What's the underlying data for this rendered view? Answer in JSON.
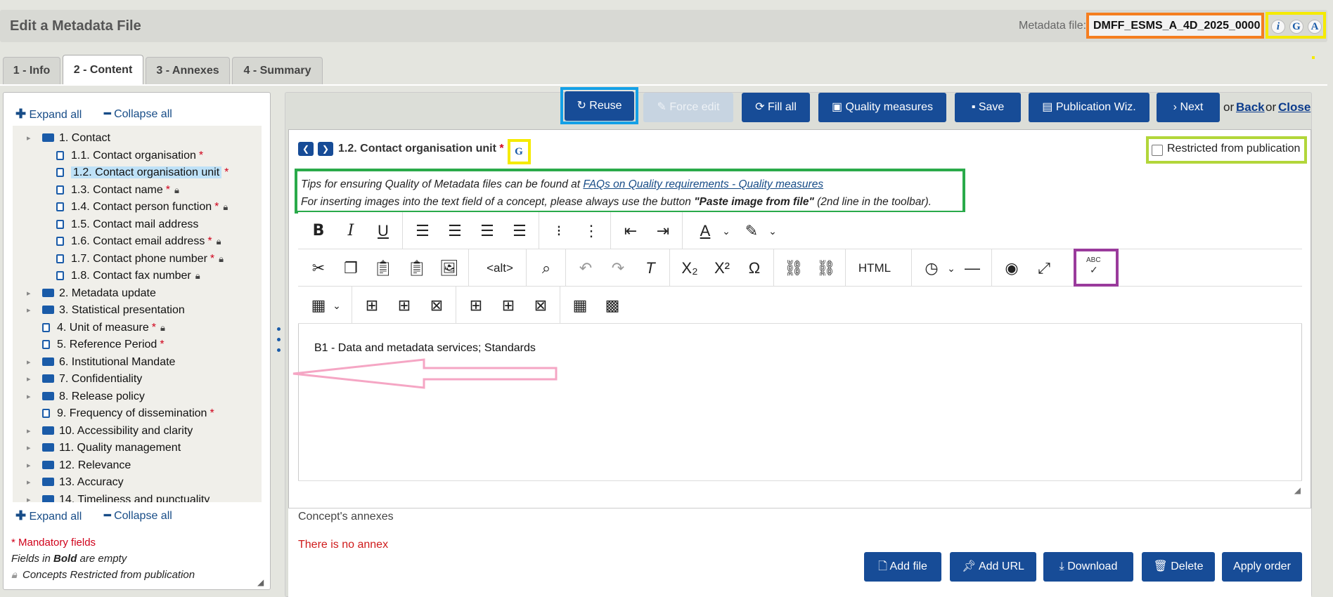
{
  "page": {
    "title": "Edit a Metadata File",
    "metadata_label": "Metadata file:",
    "metadata_id": "DMFF_ESMS_A_4D_2025_0000",
    "help_icons": [
      "i",
      "G",
      "A"
    ]
  },
  "tabs": [
    "1 - Info",
    "2 - Content",
    "3 - Annexes",
    "4 - Summary"
  ],
  "tree_controls": {
    "expand": "Expand all",
    "collapse": "Collapse all"
  },
  "tree": [
    {
      "label": "1. Contact",
      "type": "folder",
      "level": 0
    },
    {
      "label": "1.1. Contact organisation",
      "type": "doc",
      "level": 1,
      "mandatory": true
    },
    {
      "label": "1.2. Contact organisation unit",
      "type": "doc",
      "level": 1,
      "mandatory": true,
      "selected": true
    },
    {
      "label": "1.3. Contact name",
      "type": "doc",
      "level": 1,
      "mandatory": true,
      "restricted": true
    },
    {
      "label": "1.4. Contact person function",
      "type": "doc",
      "level": 1,
      "mandatory": true,
      "restricted": true
    },
    {
      "label": "1.5. Contact mail address",
      "type": "doc",
      "level": 1
    },
    {
      "label": "1.6. Contact email address",
      "type": "doc",
      "level": 1,
      "mandatory": true,
      "restricted": true
    },
    {
      "label": "1.7. Contact phone number",
      "type": "doc",
      "level": 1,
      "mandatory": true,
      "restricted": true
    },
    {
      "label": "1.8. Contact fax number",
      "type": "doc",
      "level": 1,
      "restricted": true
    },
    {
      "label": "2. Metadata update",
      "type": "folder",
      "level": 0
    },
    {
      "label": "3. Statistical presentation",
      "type": "folder",
      "level": 0
    },
    {
      "label": "4. Unit of measure",
      "type": "doc",
      "level": 0,
      "mandatory": true,
      "restricted": true
    },
    {
      "label": "5. Reference Period",
      "type": "doc",
      "level": 0,
      "mandatory": true
    },
    {
      "label": "6. Institutional Mandate",
      "type": "folder",
      "level": 0
    },
    {
      "label": "7. Confidentiality",
      "type": "folder",
      "level": 0
    },
    {
      "label": "8. Release policy",
      "type": "folder",
      "level": 0
    },
    {
      "label": "9. Frequency of dissemination",
      "type": "doc",
      "level": 0,
      "mandatory": true
    },
    {
      "label": "10. Accessibility and clarity",
      "type": "folder",
      "level": 0
    },
    {
      "label": "11. Quality management",
      "type": "folder",
      "level": 0
    },
    {
      "label": "12. Relevance",
      "type": "folder",
      "level": 0
    },
    {
      "label": "13. Accuracy",
      "type": "folder",
      "level": 0
    },
    {
      "label": "14. Timeliness and punctuality",
      "type": "folder",
      "level": 0
    }
  ],
  "legend": {
    "mandatory": "* Mandatory fields",
    "bold_prefix": "Fields in ",
    "bold_word": "Bold",
    "bold_suffix": " are empty",
    "restricted": "Concepts Restricted from publication"
  },
  "actions": {
    "reuse": "Reuse",
    "force_edit": "Force edit",
    "fill_all": "Fill all",
    "quality": "Quality measures",
    "save": "Save",
    "publication": "Publication Wiz.",
    "next": "Next",
    "or1": "or",
    "back": "Back",
    "or2": "or",
    "close": "Close"
  },
  "concept": {
    "title": "1.2. Contact organisation unit",
    "mandatory_star": "*",
    "restricted_label": "Restricted from publication",
    "tip1_prefix": "Tips for ensuring Quality of Metadata files can be found at ",
    "tip1_link": "FAQs on Quality requirements - Quality measures",
    "tip2_prefix": "For inserting images into the text field of a concept, please always use the button ",
    "tip2_bold": "\"Paste image from file\"",
    "tip2_suffix": " (2nd line in the toolbar).",
    "content": "B1 - Data and metadata services; Standards"
  },
  "toolbar": {
    "alt_label": "<alt>",
    "html_label": "HTML",
    "spell_label": "ABC"
  },
  "annexes": {
    "title": "Concept's annexes",
    "empty": "There is no annex",
    "add_file": "Add file",
    "add_url": "Add URL",
    "download": "Download",
    "delete": "Delete",
    "apply_order": "Apply order"
  },
  "colors": {
    "primary": "#174c97",
    "mandatory": "#d0021b",
    "highlight_orange": "#f57e20",
    "highlight_yellow": "#f5ea00",
    "highlight_blue": "#14a0e6",
    "highlight_green": "#2aaa4a",
    "highlight_lime": "#b2d63a",
    "highlight_purple": "#9a3b9c",
    "arrow": "#f5a6c4"
  }
}
